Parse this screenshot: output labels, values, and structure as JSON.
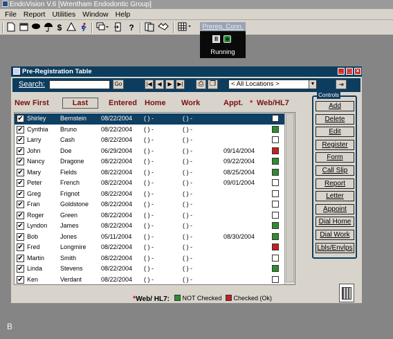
{
  "app": {
    "title": "EndoVision V.6 [Wrentham Endodontic Group]",
    "menu": [
      "File",
      "Report",
      "Utilities",
      "Window",
      "Help"
    ]
  },
  "toolbar": {
    "icons": [
      "new-doc-icon",
      "calendar-icon",
      "piggy-bank-icon",
      "umbrella-icon",
      "dollar-icon",
      "warning-icon",
      "runner-icon",
      "window-icon",
      "exit-door-icon",
      "help-icon",
      "notes-icon",
      "handshake-icon",
      "grid-icon"
    ],
    "dollar": "$",
    "help": "?"
  },
  "prereg_conn": {
    "label": "Prereg. Conn.",
    "status": "Running",
    "pause": "II"
  },
  "window": {
    "title": "Pre-Registration Table"
  },
  "search": {
    "label": "Search:",
    "value": "",
    "go": "Go",
    "location": "< All Locations >"
  },
  "columns": {
    "new": "New",
    "first": "First",
    "last": "Last",
    "entered": "Entered",
    "home": "Home",
    "work": "Work",
    "appt": "Appt.",
    "asterisk": "*",
    "web": "Web/HL7"
  },
  "rows": [
    {
      "first": "Shirley",
      "last": "Bernstein",
      "entered": "08/22/2004",
      "home": "(   )  -",
      "work": "(   )  -",
      "appt": "",
      "web": "none",
      "selected": true
    },
    {
      "first": "Cynthia",
      "last": "Bruno",
      "entered": "08/22/2004",
      "home": "(   )  -",
      "work": "(   )  -",
      "appt": "",
      "web": "ok"
    },
    {
      "first": "Larry",
      "last": "Cash",
      "entered": "08/22/2004",
      "home": "(   )  -",
      "work": "(   )  -",
      "appt": "",
      "web": "none"
    },
    {
      "first": "John",
      "last": "Doe",
      "entered": "06/29/2004",
      "home": "(   )  -",
      "work": "(   )  -",
      "appt": "09/14/2004",
      "web": "red"
    },
    {
      "first": "Nancy",
      "last": "Dragone",
      "entered": "08/22/2004",
      "home": "(   )  -",
      "work": "(   )  -",
      "appt": "09/22/2004",
      "web": "ok"
    },
    {
      "first": "Mary",
      "last": "Fields",
      "entered": "08/22/2004",
      "home": "(   )  -",
      "work": "(   )  -",
      "appt": "08/25/2004",
      "web": "ok"
    },
    {
      "first": "Peter",
      "last": "French",
      "entered": "08/22/2004",
      "home": "(   )  -",
      "work": "(   )  -",
      "appt": "09/01/2004",
      "web": "none"
    },
    {
      "first": "Greg",
      "last": "Frignot",
      "entered": "08/22/2004",
      "home": "(   )  -",
      "work": "(   )  -",
      "appt": "",
      "web": "none"
    },
    {
      "first": "Fran",
      "last": "Goldstone",
      "entered": "08/22/2004",
      "home": "(   )  -",
      "work": "(   )  -",
      "appt": "",
      "web": "none"
    },
    {
      "first": "Roger",
      "last": "Green",
      "entered": "08/22/2004",
      "home": "(   )  -",
      "work": "(   )  -",
      "appt": "",
      "web": "none"
    },
    {
      "first": "Lyndon",
      "last": "James",
      "entered": "08/22/2004",
      "home": "(   )  -",
      "work": "(   )  -",
      "appt": "",
      "web": "ok"
    },
    {
      "first": "Bob",
      "last": "Jones",
      "entered": "05/11/2004",
      "home": "(   )  -",
      "work": "(   )  -",
      "appt": "08/30/2004",
      "web": "ok"
    },
    {
      "first": "Fred",
      "last": "Longmire",
      "entered": "08/22/2004",
      "home": "(   )  -",
      "work": "(   )  -",
      "appt": "",
      "web": "red"
    },
    {
      "first": "Martin",
      "last": "Smith",
      "entered": "08/22/2004",
      "home": "(   )  -",
      "work": "(   )  -",
      "appt": "",
      "web": "none"
    },
    {
      "first": "Linda",
      "last": "Stevens",
      "entered": "08/22/2004",
      "home": "(   )  -",
      "work": "(   )  -",
      "appt": "",
      "web": "ok"
    },
    {
      "first": "Ken",
      "last": "Verdant",
      "entered": "08/22/2004",
      "home": "(   )  -",
      "work": "(   )  -",
      "appt": "",
      "web": "none"
    }
  ],
  "legend": {
    "asterisk": "*",
    "label": "Web/ HL7:",
    "not_checked": "NOT Checked",
    "checked": "Checked (Ok)",
    "green": "#2f8c2f",
    "red": "#c42020"
  },
  "controls": {
    "header": "Controls",
    "buttons": [
      "Add",
      "Delete",
      "Edit",
      "Register",
      "Form",
      "Call Slip",
      "Report",
      "Letter",
      "Appoint",
      "Dial Home",
      "Dial Work",
      "Lbls/Envlps"
    ]
  },
  "figure_label": "B"
}
